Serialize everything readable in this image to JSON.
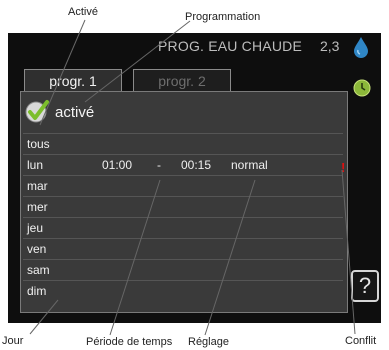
{
  "annotations": {
    "active": "Activé",
    "programming": "Programmation",
    "day": "Jour",
    "time_period": "Période de temps",
    "setting": "Réglage",
    "conflict": "Conflit"
  },
  "header": {
    "title": "PROG. EAU CHAUDE",
    "number": "2,3"
  },
  "tabs": [
    {
      "label": "progr. 1"
    },
    {
      "label": "progr. 2"
    }
  ],
  "status": {
    "label": "activé"
  },
  "days": [
    {
      "day": "tous",
      "start": "",
      "dash": "",
      "end": "",
      "mode": ""
    },
    {
      "day": "lun",
      "start": "01:00",
      "dash": "-",
      "end": "00:15",
      "mode": "normal"
    },
    {
      "day": "mar",
      "start": "",
      "dash": "",
      "end": "",
      "mode": ""
    },
    {
      "day": "mer",
      "start": "",
      "dash": "",
      "end": "",
      "mode": ""
    },
    {
      "day": "jeu",
      "start": "",
      "dash": "",
      "end": "",
      "mode": ""
    },
    {
      "day": "ven",
      "start": "",
      "dash": "",
      "end": "",
      "mode": ""
    },
    {
      "day": "sam",
      "start": "",
      "dash": "",
      "end": "",
      "mode": ""
    },
    {
      "day": "dim",
      "start": "",
      "dash": "",
      "end": "",
      "mode": ""
    }
  ],
  "conflict_mark": "!",
  "help": {
    "label": "?"
  },
  "colors": {
    "water_drop": "#2f86c6",
    "clock_green": "#8cb83a",
    "check_green": "#7cbe2c",
    "conflict_red": "#e01010"
  }
}
